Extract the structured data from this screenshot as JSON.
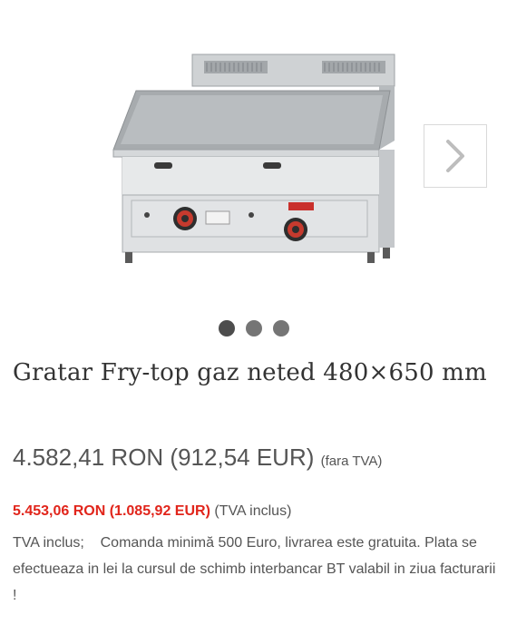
{
  "gallery": {
    "image_alt": "Gratar Fry-top gaz neted 480×650 mm",
    "next_icon": "chevron-right-icon",
    "dots_count": 3,
    "active_dot": 0
  },
  "product": {
    "title": "Gratar Fry-top gaz neted 480×650 mm",
    "price_net": "4.582,41 RON (912,54 EUR)",
    "price_net_note": "(fara TVA)",
    "price_gross": "5.453,06 RON (1.085,92 EUR)",
    "price_gross_note": "(TVA inclus)",
    "info": "TVA inclus;    Comanda minimă 500 Euro, livrarea este gratuita. Plata se efectueaza in lei la cursul de schimb interbancar BT valabil in ziua facturarii !"
  },
  "colors": {
    "accent_price": "#e1251b",
    "text": "#555555",
    "title": "#333333"
  }
}
